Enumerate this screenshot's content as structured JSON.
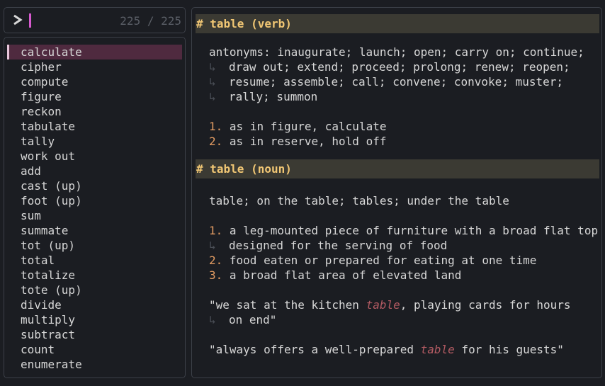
{
  "prompt": {
    "symbol": ">",
    "counter": "225 / 225"
  },
  "accent_colors": {
    "cursor": "#d65acf",
    "header_text": "#f0c674",
    "number": "#e29b62",
    "highlight": "#b25a62",
    "selected_bg": "#4f2a3f"
  },
  "list": {
    "selected_index": 0,
    "items": [
      "calculate",
      "cipher",
      "compute",
      "figure",
      "reckon",
      "tabulate",
      "tally",
      "work out",
      "add",
      "cast (up)",
      "foot (up)",
      "sum",
      "summate",
      "tot (up)",
      "total",
      "totalize",
      "tote (up)",
      "divide",
      "multiply",
      "subtract",
      "count",
      "enumerate"
    ]
  },
  "detail": {
    "verb": {
      "header": "# table (verb)",
      "antonyms_lines": [
        "antonyms: inaugurate; launch; open; carry on; continue;",
        "draw out; extend; proceed; prolong; renew; reopen;",
        "resume; assemble; call; convene; convoke; muster;",
        "rally; summon"
      ],
      "senses": [
        {
          "num": "1.",
          "text": "as in figure, calculate"
        },
        {
          "num": "2.",
          "text": "as in reserve, hold off"
        }
      ]
    },
    "noun": {
      "header": "# table (noun)",
      "forms": "table; on the table; tables; under the table",
      "senses": [
        {
          "num": "1.",
          "lines": [
            "a leg-mounted piece of furniture with a broad flat top",
            "designed for the serving of food"
          ]
        },
        {
          "num": "2.",
          "lines": [
            "food eaten or prepared for eating at one time"
          ]
        },
        {
          "num": "3.",
          "lines": [
            "a broad flat area of elevated land"
          ]
        }
      ],
      "example1": {
        "pre": "\"we sat at the kitchen ",
        "word": "table",
        "post": ", playing cards for hours",
        "cont": "on end\""
      },
      "example2": {
        "pre": "\"always offers a well-prepared ",
        "word": "table",
        "post": " for his guests\""
      }
    }
  }
}
